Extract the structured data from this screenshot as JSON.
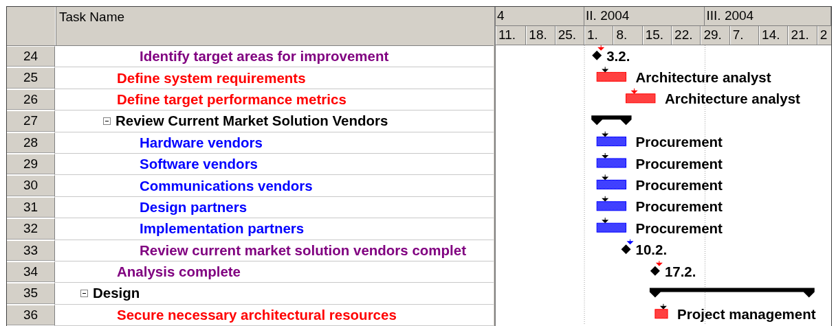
{
  "table": {
    "columns": [
      "Task Name"
    ]
  },
  "timescale": {
    "months": [
      "4",
      "II. 2004",
      "III. 2004"
    ],
    "weeks": [
      "11.",
      "18.",
      "25.",
      "1.",
      "8.",
      "15.",
      "22.",
      "29.",
      "7.",
      "14.",
      "21.",
      "2"
    ]
  },
  "tasks": [
    {
      "children": [
        {
          "children": [
            {
              "id": "24",
              "name": "Identify target areas for improvement",
              "kind": "milestone",
              "bar": {
                "kind": "milestone",
                "label": "3.2.",
                "color": "#ff0000"
              }
            }
          ]
        },
        {
          "id": "25",
          "name": "Define system requirements",
          "kind": "critical",
          "bar": {
            "kind": "critical",
            "label": "Architecture analyst",
            "color": "#000000"
          }
        },
        {
          "id": "26",
          "name": "Define target performance metrics",
          "kind": "critical",
          "bar": {
            "kind": "critical",
            "label": "Architecture analyst",
            "color": "#ff0000"
          }
        },
        {
          "id": "27",
          "name": "Review Current Market Solution Vendors",
          "kind": "summary",
          "expanded": true,
          "bar": {
            "kind": "summary"
          },
          "children": [
            {
              "id": "28",
              "name": "Hardware vendors",
              "kind": "task",
              "bar": {
                "kind": "task",
                "label": "Procurement",
                "color": "#000000"
              }
            },
            {
              "id": "29",
              "name": "Software vendors",
              "kind": "task",
              "bar": {
                "kind": "task",
                "label": "Procurement",
                "color": "#000000"
              }
            },
            {
              "id": "30",
              "name": "Communications vendors",
              "kind": "task",
              "bar": {
                "kind": "task",
                "label": "Procurement",
                "color": "#000000"
              }
            },
            {
              "id": "31",
              "name": "Design partners",
              "kind": "task",
              "bar": {
                "kind": "task",
                "label": "Procurement",
                "color": "#000000"
              }
            },
            {
              "id": "32",
              "name": "Implementation partners",
              "kind": "task",
              "bar": {
                "kind": "task",
                "label": "Procurement",
                "color": "#000000"
              }
            },
            {
              "id": "33",
              "name": "Review current market solution vendors complet",
              "kind": "milestone",
              "bar": {
                "kind": "milestone",
                "label": "10.2.",
                "color": "#0000ff"
              }
            }
          ]
        },
        {
          "id": "34",
          "name": "Analysis complete",
          "kind": "milestone",
          "bar": {
            "kind": "milestone",
            "label": "17.2.",
            "color": "#ff0000"
          }
        }
      ]
    },
    {
      "id": "35",
      "name": "Design",
      "kind": "summary",
      "expanded": true,
      "bar": {
        "kind": "summary"
      },
      "children": [
        {
          "id": "36",
          "name": "Secure necessary architectural resources",
          "kind": "critical",
          "bar": {
            "kind": "critical",
            "label": "Project management",
            "color": "#000000"
          }
        }
      ]
    }
  ]
}
